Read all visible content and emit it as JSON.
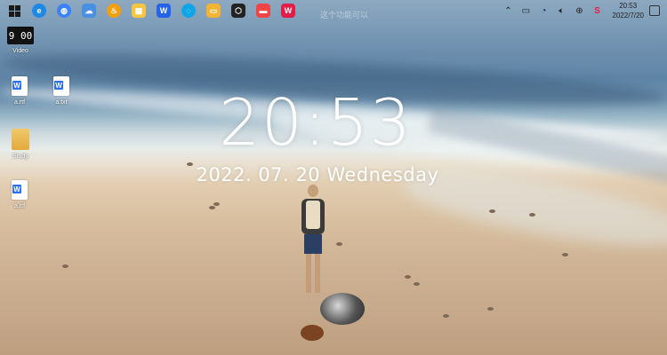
{
  "taskbar": {
    "apps": [
      {
        "name": "windows-start-icon",
        "color": "#1a1a1a"
      },
      {
        "name": "edge-icon",
        "color": "#1e88e5"
      },
      {
        "name": "globe-browser-icon",
        "color": "#3b82f6"
      },
      {
        "name": "cloud-drive-icon",
        "color": "#4a90e2"
      },
      {
        "name": "fire-app-icon",
        "color": "#f59e0b"
      },
      {
        "name": "image-viewer-icon",
        "color": "#f5c542"
      },
      {
        "name": "wps-writer-icon",
        "color": "#2563eb"
      },
      {
        "name": "chat-app-icon",
        "color": "#0ea5e9"
      },
      {
        "name": "file-explorer-icon",
        "color": "#f2b233"
      },
      {
        "name": "terminal-app-icon",
        "color": "#222222"
      },
      {
        "name": "presentation-app-icon",
        "color": "#ef4444"
      },
      {
        "name": "wps-office-icon",
        "color": "#e11d48"
      }
    ],
    "ghost_text": "这个功能可以",
    "tray": {
      "time": "20:53",
      "date": "2022/7/20"
    }
  },
  "desktop_icons": [
    {
      "label": "Video",
      "kind": "video",
      "tile_text": "9 00"
    },
    {
      "label": "a.rtf",
      "kind": "doc"
    },
    {
      "label": "a.txt",
      "kind": "doc"
    },
    {
      "label": "Study",
      "kind": "folder"
    },
    {
      "label": "a.rtf",
      "kind": "doc"
    }
  ],
  "lock": {
    "time": "20:53",
    "date": "2022. 07. 20  Wednesday"
  }
}
